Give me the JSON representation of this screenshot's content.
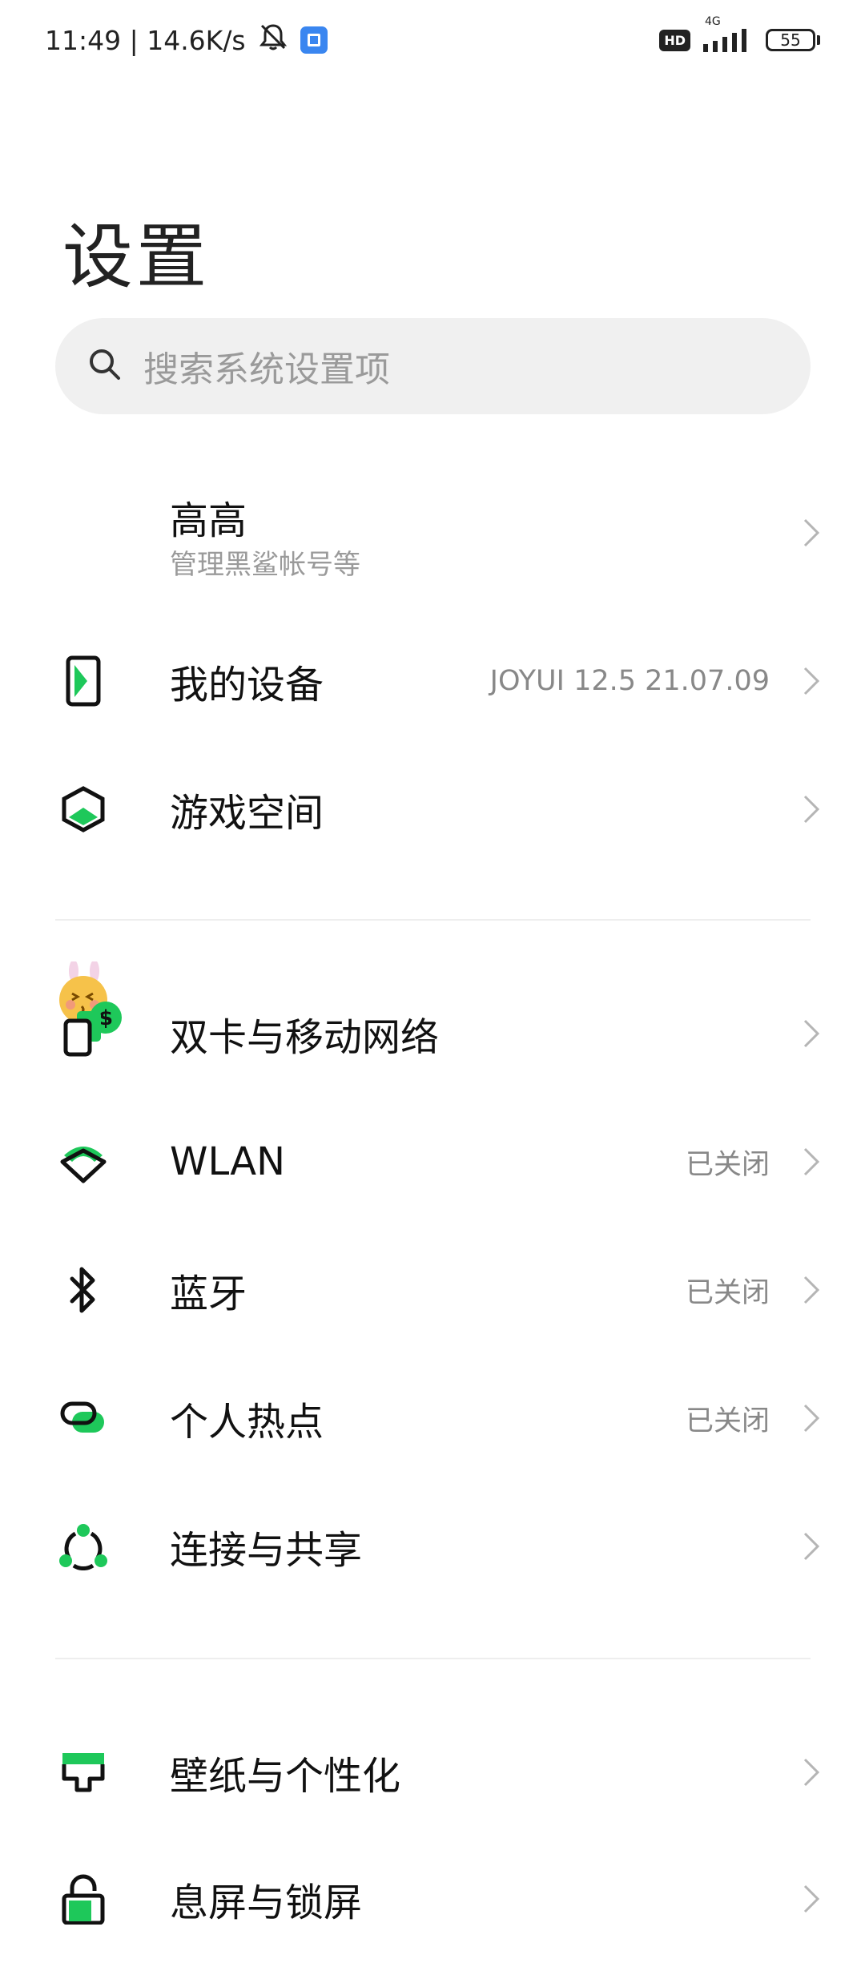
{
  "status_bar": {
    "time_speed": "11:49 | 14.6K/s",
    "hd": "HD",
    "network": "4G",
    "battery": "55"
  },
  "page": {
    "title": "设置"
  },
  "search": {
    "placeholder": "搜索系统设置项"
  },
  "account": {
    "name": "高高",
    "subtitle": "管理黑鲨帐号等"
  },
  "rows": [
    {
      "label": "我的设备",
      "value": "JOYUI 12.5 21.07.09",
      "icon": "phone-device-icon"
    },
    {
      "label": "游戏空间",
      "value": "",
      "icon": "game-space-icon"
    },
    {
      "label": "双卡与移动网络",
      "value": "",
      "icon": "sim-card-icon"
    },
    {
      "label": "WLAN",
      "value": "已关闭",
      "icon": "wifi-icon"
    },
    {
      "label": "蓝牙",
      "value": "已关闭",
      "icon": "bluetooth-icon"
    },
    {
      "label": "个人热点",
      "value": "已关闭",
      "icon": "hotspot-icon"
    },
    {
      "label": "连接与共享",
      "value": "",
      "icon": "share-connect-icon"
    },
    {
      "label": "壁纸与个性化",
      "value": "",
      "icon": "wallpaper-icon"
    },
    {
      "label": "息屏与锁屏",
      "value": "",
      "icon": "lock-icon"
    }
  ],
  "colors": {
    "accent": "#1ec85a",
    "icon_stroke": "#111111",
    "secondary_text": "#888888",
    "search_bg": "#f0f0f0"
  }
}
